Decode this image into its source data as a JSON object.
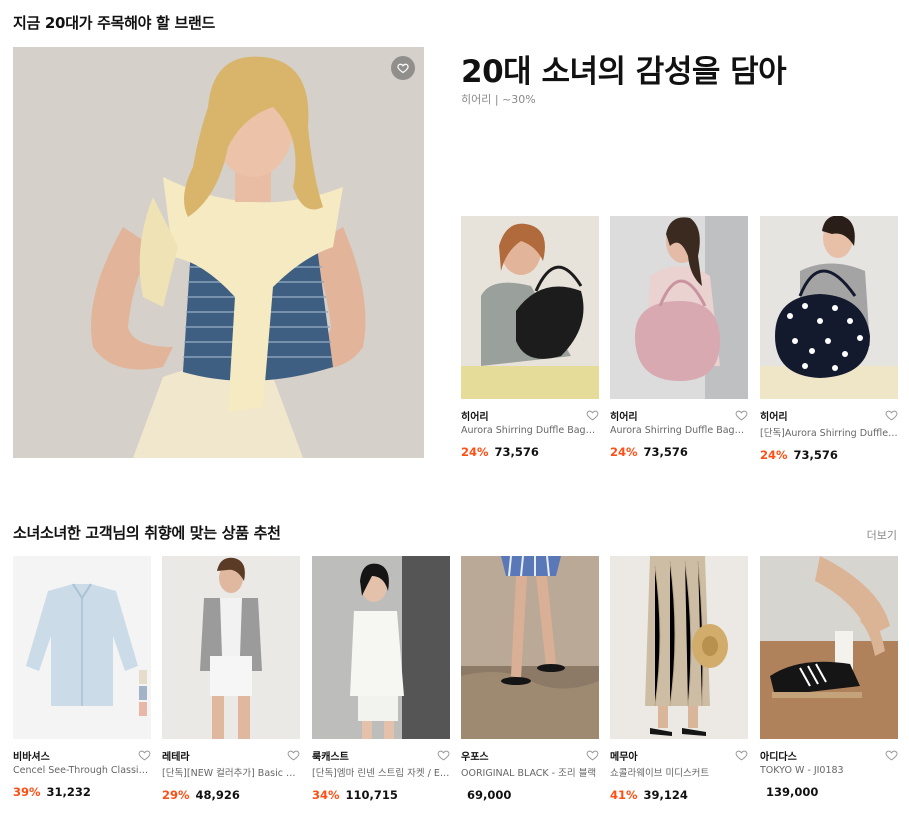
{
  "section1": {
    "title": "지금 20대가 주목해야 할 브랜드",
    "headline": "20대 소녀의 감성을 담아",
    "subline": "히어리 | ~30%",
    "products": [
      {
        "brand": "히어리",
        "name": "Aurora Shirring Duffle Bag_Black",
        "discount": "24%",
        "price": "73,576"
      },
      {
        "brand": "히어리",
        "name": "Aurora Shirring Duffle Bag_Lilac",
        "discount": "24%",
        "price": "73,576"
      },
      {
        "brand": "히어리",
        "name": "[단독]Aurora Shirring Duffle Bag_Dot",
        "discount": "24%",
        "price": "73,576"
      }
    ]
  },
  "section2": {
    "title": "소녀소녀한 고객님의 취향에 맞는 상품 추천",
    "more_label": "더보기",
    "products": [
      {
        "brand": "비바셔스",
        "name": "Cencel See-Through Classic Shirt",
        "discount": "39%",
        "price": "31,232"
      },
      {
        "brand": "레테라",
        "name": "[단독][NEW 컬러추가] Basic Round Cardigan",
        "discount": "29%",
        "price": "48,926"
      },
      {
        "brand": "룩캐스트",
        "name": "[단독]엠마 린넨 스트립 자켓 / EMMA",
        "discount": "34%",
        "price": "110,715"
      },
      {
        "brand": "우포스",
        "name": "OORIGINAL BLACK - 조리 블랙",
        "discount": "",
        "price": "69,000"
      },
      {
        "brand": "메무아",
        "name": "쇼콜라웨이브 미디스커트",
        "discount": "41%",
        "price": "39,124"
      },
      {
        "brand": "아디다스",
        "name": "TOKYO W - JI0183",
        "discount": "",
        "price": "139,000"
      }
    ]
  },
  "colors": {
    "discount": "#ff4f14",
    "muted": "#888888"
  },
  "icons": {
    "wishlist": "heart-icon"
  }
}
